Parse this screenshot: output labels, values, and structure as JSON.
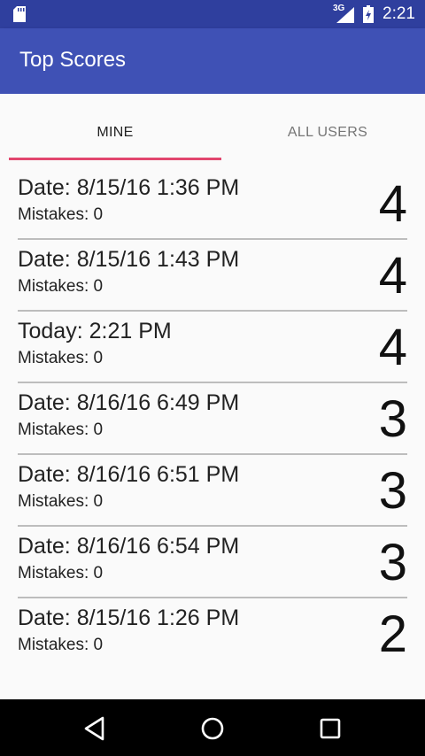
{
  "status_bar": {
    "network": "3G",
    "time": "2:21",
    "icons": [
      "sd-card-icon",
      "signal-icon",
      "battery-icon"
    ]
  },
  "app_bar": {
    "title": "Top Scores"
  },
  "tabs": [
    {
      "label": "MINE",
      "selected": true
    },
    {
      "label": "ALL USERS",
      "selected": false
    }
  ],
  "scores": [
    {
      "date": "Date: 8/15/16 1:36 PM",
      "mistakes": "Mistakes: 0",
      "score": "4"
    },
    {
      "date": "Date: 8/15/16 1:43 PM",
      "mistakes": "Mistakes: 0",
      "score": "4"
    },
    {
      "date": "Today: 2:21 PM",
      "mistakes": "Mistakes: 0",
      "score": "4"
    },
    {
      "date": "Date: 8/16/16 6:49 PM",
      "mistakes": "Mistakes: 0",
      "score": "3"
    },
    {
      "date": "Date: 8/16/16 6:51 PM",
      "mistakes": "Mistakes: 0",
      "score": "3"
    },
    {
      "date": "Date: 8/16/16 6:54 PM",
      "mistakes": "Mistakes: 0",
      "score": "3"
    },
    {
      "date": "Date: 8/15/16 1:26 PM",
      "mistakes": "Mistakes: 0",
      "score": "2"
    }
  ],
  "nav_bar": {
    "buttons": [
      "back-icon",
      "home-icon",
      "recents-icon"
    ]
  },
  "colors": {
    "status_bar": "#2f3f9e",
    "app_bar": "#3f51b5",
    "tab_indicator": "#e2466e",
    "background": "#fafafa"
  }
}
